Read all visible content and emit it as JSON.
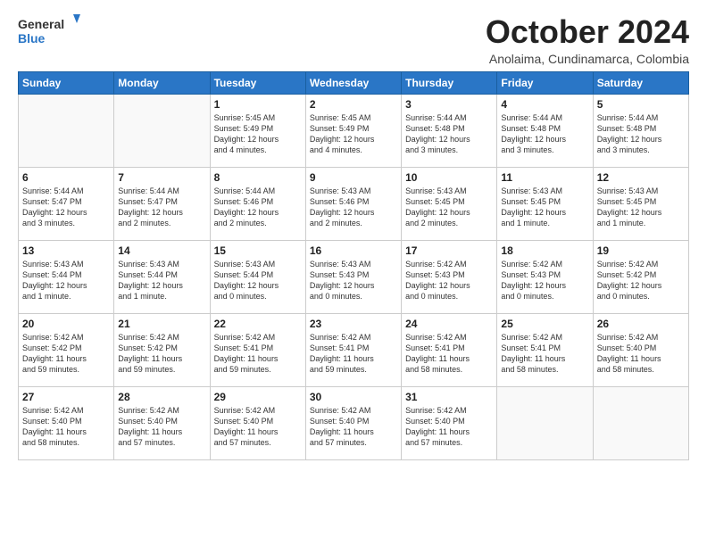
{
  "logo": {
    "line1": "General",
    "line2": "Blue"
  },
  "header": {
    "month": "October 2024",
    "location": "Anolaima, Cundinamarca, Colombia"
  },
  "weekdays": [
    "Sunday",
    "Monday",
    "Tuesday",
    "Wednesday",
    "Thursday",
    "Friday",
    "Saturday"
  ],
  "weeks": [
    [
      {
        "day": "",
        "text": ""
      },
      {
        "day": "",
        "text": ""
      },
      {
        "day": "1",
        "text": "Sunrise: 5:45 AM\nSunset: 5:49 PM\nDaylight: 12 hours\nand 4 minutes."
      },
      {
        "day": "2",
        "text": "Sunrise: 5:45 AM\nSunset: 5:49 PM\nDaylight: 12 hours\nand 4 minutes."
      },
      {
        "day": "3",
        "text": "Sunrise: 5:44 AM\nSunset: 5:48 PM\nDaylight: 12 hours\nand 3 minutes."
      },
      {
        "day": "4",
        "text": "Sunrise: 5:44 AM\nSunset: 5:48 PM\nDaylight: 12 hours\nand 3 minutes."
      },
      {
        "day": "5",
        "text": "Sunrise: 5:44 AM\nSunset: 5:48 PM\nDaylight: 12 hours\nand 3 minutes."
      }
    ],
    [
      {
        "day": "6",
        "text": "Sunrise: 5:44 AM\nSunset: 5:47 PM\nDaylight: 12 hours\nand 3 minutes."
      },
      {
        "day": "7",
        "text": "Sunrise: 5:44 AM\nSunset: 5:47 PM\nDaylight: 12 hours\nand 2 minutes."
      },
      {
        "day": "8",
        "text": "Sunrise: 5:44 AM\nSunset: 5:46 PM\nDaylight: 12 hours\nand 2 minutes."
      },
      {
        "day": "9",
        "text": "Sunrise: 5:43 AM\nSunset: 5:46 PM\nDaylight: 12 hours\nand 2 minutes."
      },
      {
        "day": "10",
        "text": "Sunrise: 5:43 AM\nSunset: 5:45 PM\nDaylight: 12 hours\nand 2 minutes."
      },
      {
        "day": "11",
        "text": "Sunrise: 5:43 AM\nSunset: 5:45 PM\nDaylight: 12 hours\nand 1 minute."
      },
      {
        "day": "12",
        "text": "Sunrise: 5:43 AM\nSunset: 5:45 PM\nDaylight: 12 hours\nand 1 minute."
      }
    ],
    [
      {
        "day": "13",
        "text": "Sunrise: 5:43 AM\nSunset: 5:44 PM\nDaylight: 12 hours\nand 1 minute."
      },
      {
        "day": "14",
        "text": "Sunrise: 5:43 AM\nSunset: 5:44 PM\nDaylight: 12 hours\nand 1 minute."
      },
      {
        "day": "15",
        "text": "Sunrise: 5:43 AM\nSunset: 5:44 PM\nDaylight: 12 hours\nand 0 minutes."
      },
      {
        "day": "16",
        "text": "Sunrise: 5:43 AM\nSunset: 5:43 PM\nDaylight: 12 hours\nand 0 minutes."
      },
      {
        "day": "17",
        "text": "Sunrise: 5:42 AM\nSunset: 5:43 PM\nDaylight: 12 hours\nand 0 minutes."
      },
      {
        "day": "18",
        "text": "Sunrise: 5:42 AM\nSunset: 5:43 PM\nDaylight: 12 hours\nand 0 minutes."
      },
      {
        "day": "19",
        "text": "Sunrise: 5:42 AM\nSunset: 5:42 PM\nDaylight: 12 hours\nand 0 minutes."
      }
    ],
    [
      {
        "day": "20",
        "text": "Sunrise: 5:42 AM\nSunset: 5:42 PM\nDaylight: 11 hours\nand 59 minutes."
      },
      {
        "day": "21",
        "text": "Sunrise: 5:42 AM\nSunset: 5:42 PM\nDaylight: 11 hours\nand 59 minutes."
      },
      {
        "day": "22",
        "text": "Sunrise: 5:42 AM\nSunset: 5:41 PM\nDaylight: 11 hours\nand 59 minutes."
      },
      {
        "day": "23",
        "text": "Sunrise: 5:42 AM\nSunset: 5:41 PM\nDaylight: 11 hours\nand 59 minutes."
      },
      {
        "day": "24",
        "text": "Sunrise: 5:42 AM\nSunset: 5:41 PM\nDaylight: 11 hours\nand 58 minutes."
      },
      {
        "day": "25",
        "text": "Sunrise: 5:42 AM\nSunset: 5:41 PM\nDaylight: 11 hours\nand 58 minutes."
      },
      {
        "day": "26",
        "text": "Sunrise: 5:42 AM\nSunset: 5:40 PM\nDaylight: 11 hours\nand 58 minutes."
      }
    ],
    [
      {
        "day": "27",
        "text": "Sunrise: 5:42 AM\nSunset: 5:40 PM\nDaylight: 11 hours\nand 58 minutes."
      },
      {
        "day": "28",
        "text": "Sunrise: 5:42 AM\nSunset: 5:40 PM\nDaylight: 11 hours\nand 57 minutes."
      },
      {
        "day": "29",
        "text": "Sunrise: 5:42 AM\nSunset: 5:40 PM\nDaylight: 11 hours\nand 57 minutes."
      },
      {
        "day": "30",
        "text": "Sunrise: 5:42 AM\nSunset: 5:40 PM\nDaylight: 11 hours\nand 57 minutes."
      },
      {
        "day": "31",
        "text": "Sunrise: 5:42 AM\nSunset: 5:40 PM\nDaylight: 11 hours\nand 57 minutes."
      },
      {
        "day": "",
        "text": ""
      },
      {
        "day": "",
        "text": ""
      }
    ]
  ]
}
